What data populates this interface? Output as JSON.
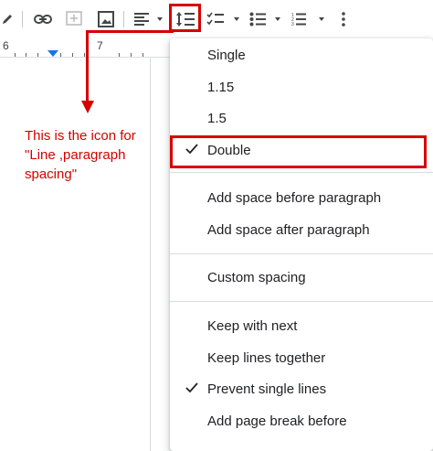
{
  "toolbar": {
    "items": [
      {
        "name": "edit-pencil-icon"
      },
      {
        "name": "insert-link-icon"
      },
      {
        "name": "add-comment-icon"
      },
      {
        "name": "insert-image-icon"
      },
      {
        "name": "align-left-icon"
      },
      {
        "name": "line-paragraph-spacing-icon"
      },
      {
        "name": "checklist-icon"
      },
      {
        "name": "bulleted-list-icon"
      },
      {
        "name": "numbered-list-icon"
      },
      {
        "name": "more-options-icon"
      }
    ]
  },
  "ruler": {
    "num_left": "6",
    "num_right": "7"
  },
  "annotation": {
    "line1": "This is the icon for",
    "line2": "\"Line ,paragraph",
    "line3": "spacing\""
  },
  "menu": {
    "items": [
      {
        "label": "Single",
        "checked": false
      },
      {
        "label": "1.15",
        "checked": false
      },
      {
        "label": "1.5",
        "checked": false
      },
      {
        "label": "Double",
        "checked": true
      },
      {
        "label": "Add space before paragraph",
        "checked": false
      },
      {
        "label": "Add space after paragraph",
        "checked": false
      },
      {
        "label": "Custom spacing",
        "checked": false
      },
      {
        "label": "Keep with next",
        "checked": false
      },
      {
        "label": "Keep lines together",
        "checked": false
      },
      {
        "label": "Prevent single lines",
        "checked": true
      },
      {
        "label": "Add page break before",
        "checked": false
      }
    ]
  },
  "colors": {
    "annotation_red": "#d50000",
    "ruler_marker": "#1a73e8"
  }
}
